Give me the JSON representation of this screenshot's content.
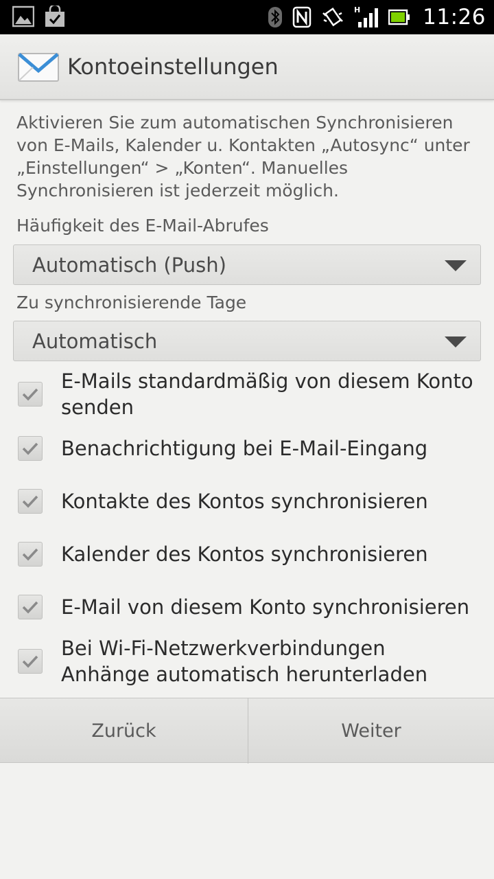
{
  "status_bar": {
    "time": "11:26",
    "icons_left": [
      "gallery-icon",
      "shopping-bag-icon"
    ],
    "icons_right": [
      "bluetooth-icon",
      "nfc-icon",
      "vibrate-icon",
      "signal-icon",
      "battery-icon"
    ]
  },
  "header": {
    "title": "Kontoeinstellungen",
    "icon": "mail-envelope-icon"
  },
  "intro": {
    "text": "Aktivieren Sie zum automatischen Synchronisieren von E-Mails, Kalender u. Kontakten „Autosync“ unter „Einstellungen“ > „Konten“. Manuelles Synchronisieren ist jederzeit möglich."
  },
  "frequency": {
    "label": "Häufigkeit des E-Mail-Abrufes",
    "value": "Automatisch (Push)"
  },
  "sync_days": {
    "label": "Zu synchronisierende Tage",
    "value": "Automatisch"
  },
  "options": [
    {
      "label": "E-Mails standardmäßig von diesem Konto senden",
      "checked": true
    },
    {
      "label": "Benachrichtigung bei E-Mail-Eingang",
      "checked": true
    },
    {
      "label": "Kontakte des Kontos synchronisieren",
      "checked": true
    },
    {
      "label": "Kalender des Kontos synchronisieren",
      "checked": true
    },
    {
      "label": "E-Mail von diesem Konto synchronisieren",
      "checked": true
    },
    {
      "label": "Bei Wi-Fi-Netzwerkverbindungen Anhänge automatisch herunterladen",
      "checked": true
    }
  ],
  "buttons": {
    "back_label": "Zurück",
    "next_label": "Weiter"
  },
  "colors": {
    "background": "#f2f2f0",
    "check_mark": "#8a8a8a",
    "status_bar": "#000000"
  }
}
